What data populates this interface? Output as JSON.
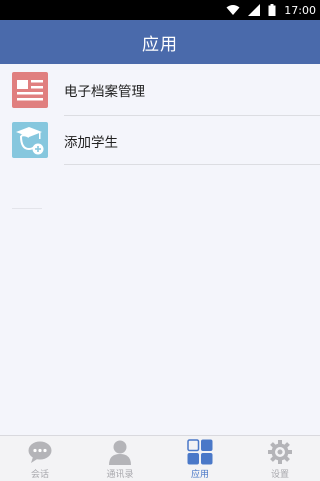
{
  "status_bar": {
    "time": "17:00"
  },
  "app_bar": {
    "title": "应用"
  },
  "list": {
    "items": [
      {
        "label": "电子档案管理",
        "icon": "document-list-icon",
        "icon_color": "#e07f7f"
      },
      {
        "label": "添加学生",
        "icon": "graduate-add-icon",
        "icon_color": "#86c7de"
      }
    ]
  },
  "tab_bar": {
    "tabs": [
      {
        "label": "会话",
        "icon": "chat-bubble-icon",
        "active": false
      },
      {
        "label": "通讯录",
        "icon": "contact-person-icon",
        "active": false
      },
      {
        "label": "应用",
        "icon": "apps-grid-icon",
        "active": true
      },
      {
        "label": "设置",
        "icon": "gear-icon",
        "active": false
      }
    ]
  },
  "colors": {
    "primary": "#4a6aab",
    "active_tab": "#4a78c8",
    "inactive_tab": "#a8a8ad"
  }
}
